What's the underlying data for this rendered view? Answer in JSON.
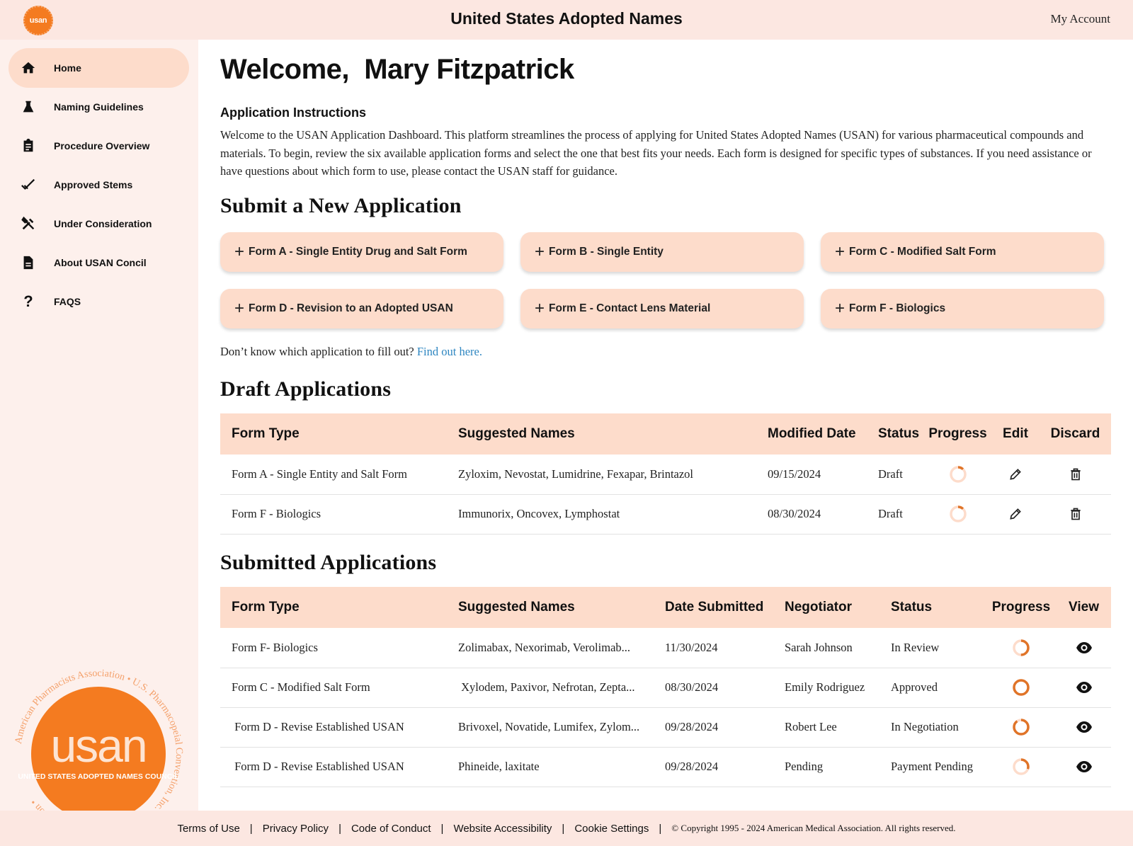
{
  "header": {
    "logo_text": "usan",
    "title": "United States Adopted Names",
    "account_label": "My Account"
  },
  "sidebar": {
    "items": [
      {
        "label": "Home",
        "icon": "home-icon",
        "active": true
      },
      {
        "label": "Naming Guidelines",
        "icon": "flask-icon",
        "active": false
      },
      {
        "label": "Procedure Overview",
        "icon": "clipboard-icon",
        "active": false
      },
      {
        "label": "Approved Stems",
        "icon": "double-check-icon",
        "active": false
      },
      {
        "label": "Under Consideration",
        "icon": "tools-icon",
        "active": false
      },
      {
        "label": "About USAN Concil",
        "icon": "document-icon",
        "active": false
      },
      {
        "label": "FAQS",
        "icon": "question-icon",
        "active": false
      }
    ],
    "seal": {
      "wordmark": "usan",
      "council": "UNITED STATES ADOPTED NAMES COUNCIL",
      "ring_text": "American Pharmacists Association • U.S. Pharmacopeial Convention, Inc. • American Medical Association •"
    }
  },
  "main": {
    "welcome": "Welcome,  Mary Fitzpatrick",
    "instructions_title": "Application Instructions",
    "instructions_body": "Welcome to the USAN Application Dashboard. This platform streamlines the process of applying for United States Adopted Names (USAN) for various pharmaceutical compounds and materials. To begin, review the six available application forms and select the one that best fits your needs. Each form is designed for specific types of substances. If you need assistance or have questions about which form to use, please contact the USAN staff for guidance.",
    "submit_title": "Submit a New Application",
    "forms": [
      {
        "label": "Form A - Single Entity Drug and Salt Form"
      },
      {
        "label": "Form B - Single Entity"
      },
      {
        "label": "Form C - Modified Salt Form"
      },
      {
        "label": "Form D - Revision to an Adopted USAN"
      },
      {
        "label": "Form E - Contact Lens Material"
      },
      {
        "label": "Form F - Biologics"
      }
    ],
    "help_text": "Don’t know which application to fill out?",
    "help_link": "Find out here.",
    "draft": {
      "title": "Draft Applications",
      "columns": [
        "Form Type",
        "Suggested Names",
        "Modified Date",
        "Status",
        "Progress",
        "Edit",
        "Discard"
      ],
      "rows": [
        {
          "form_type": "Form A - Single Entity and Salt Form",
          "names": "Zyloxim, Nevostat, Lumidrine, Fexapar, Brintazol",
          "date": "09/15/2024",
          "status": "Draft",
          "progress": 0.12
        },
        {
          "form_type": "Form F - Biologics",
          "names": "Immunorix, Oncovex, Lymphostat",
          "date": "08/30/2024",
          "status": "Draft",
          "progress": 0.12
        }
      ]
    },
    "submitted": {
      "title": "Submitted Applications",
      "columns": [
        "Form Type",
        "Suggested Names",
        "Date Submitted",
        "Negotiator",
        "Status",
        "Progress",
        "View"
      ],
      "rows": [
        {
          "form_type": "Form F- Biologics",
          "names": "Zolimabax, Nexorimab, Verolimab...",
          "date": "11/30/2024",
          "negotiator": "Sarah Johnson",
          "status": "In Review",
          "progress": 0.5
        },
        {
          "form_type": "Form C - Modified Salt Form",
          "names": " Xylodem, Paxivor, Nefrotan, Zepta...",
          "date": "08/30/2024",
          "negotiator": "Emily Rodriguez",
          "status": "Approved",
          "progress": 1.0
        },
        {
          "form_type": " Form D - Revise Established USAN",
          "names": "Brivoxel, Novatide, Lumifex, Zylom...",
          "date": "09/28/2024",
          "negotiator": "Robert Lee",
          "status": "In Negotiation",
          "progress": 0.9
        },
        {
          "form_type": " Form D - Revise Established USAN",
          "names": "Phineide, laxitate",
          "date": "09/28/2024",
          "negotiator": "Pending",
          "status": "Payment Pending",
          "progress": 0.3
        }
      ]
    }
  },
  "footer": {
    "links": [
      "Terms of Use",
      "Privacy Policy",
      "Code of Conduct",
      "Website Accessibility",
      "Cookie Settings"
    ],
    "separator": "|",
    "copyright": "© Copyright 1995 - 2024 American Medical Association. All rights reserved."
  },
  "colors": {
    "brand_orange": "#f47b20",
    "progress_track": "#fddccb",
    "progress_fill": "#e07428",
    "accent_bg": "#fddccb",
    "link": "#2e86c1"
  }
}
